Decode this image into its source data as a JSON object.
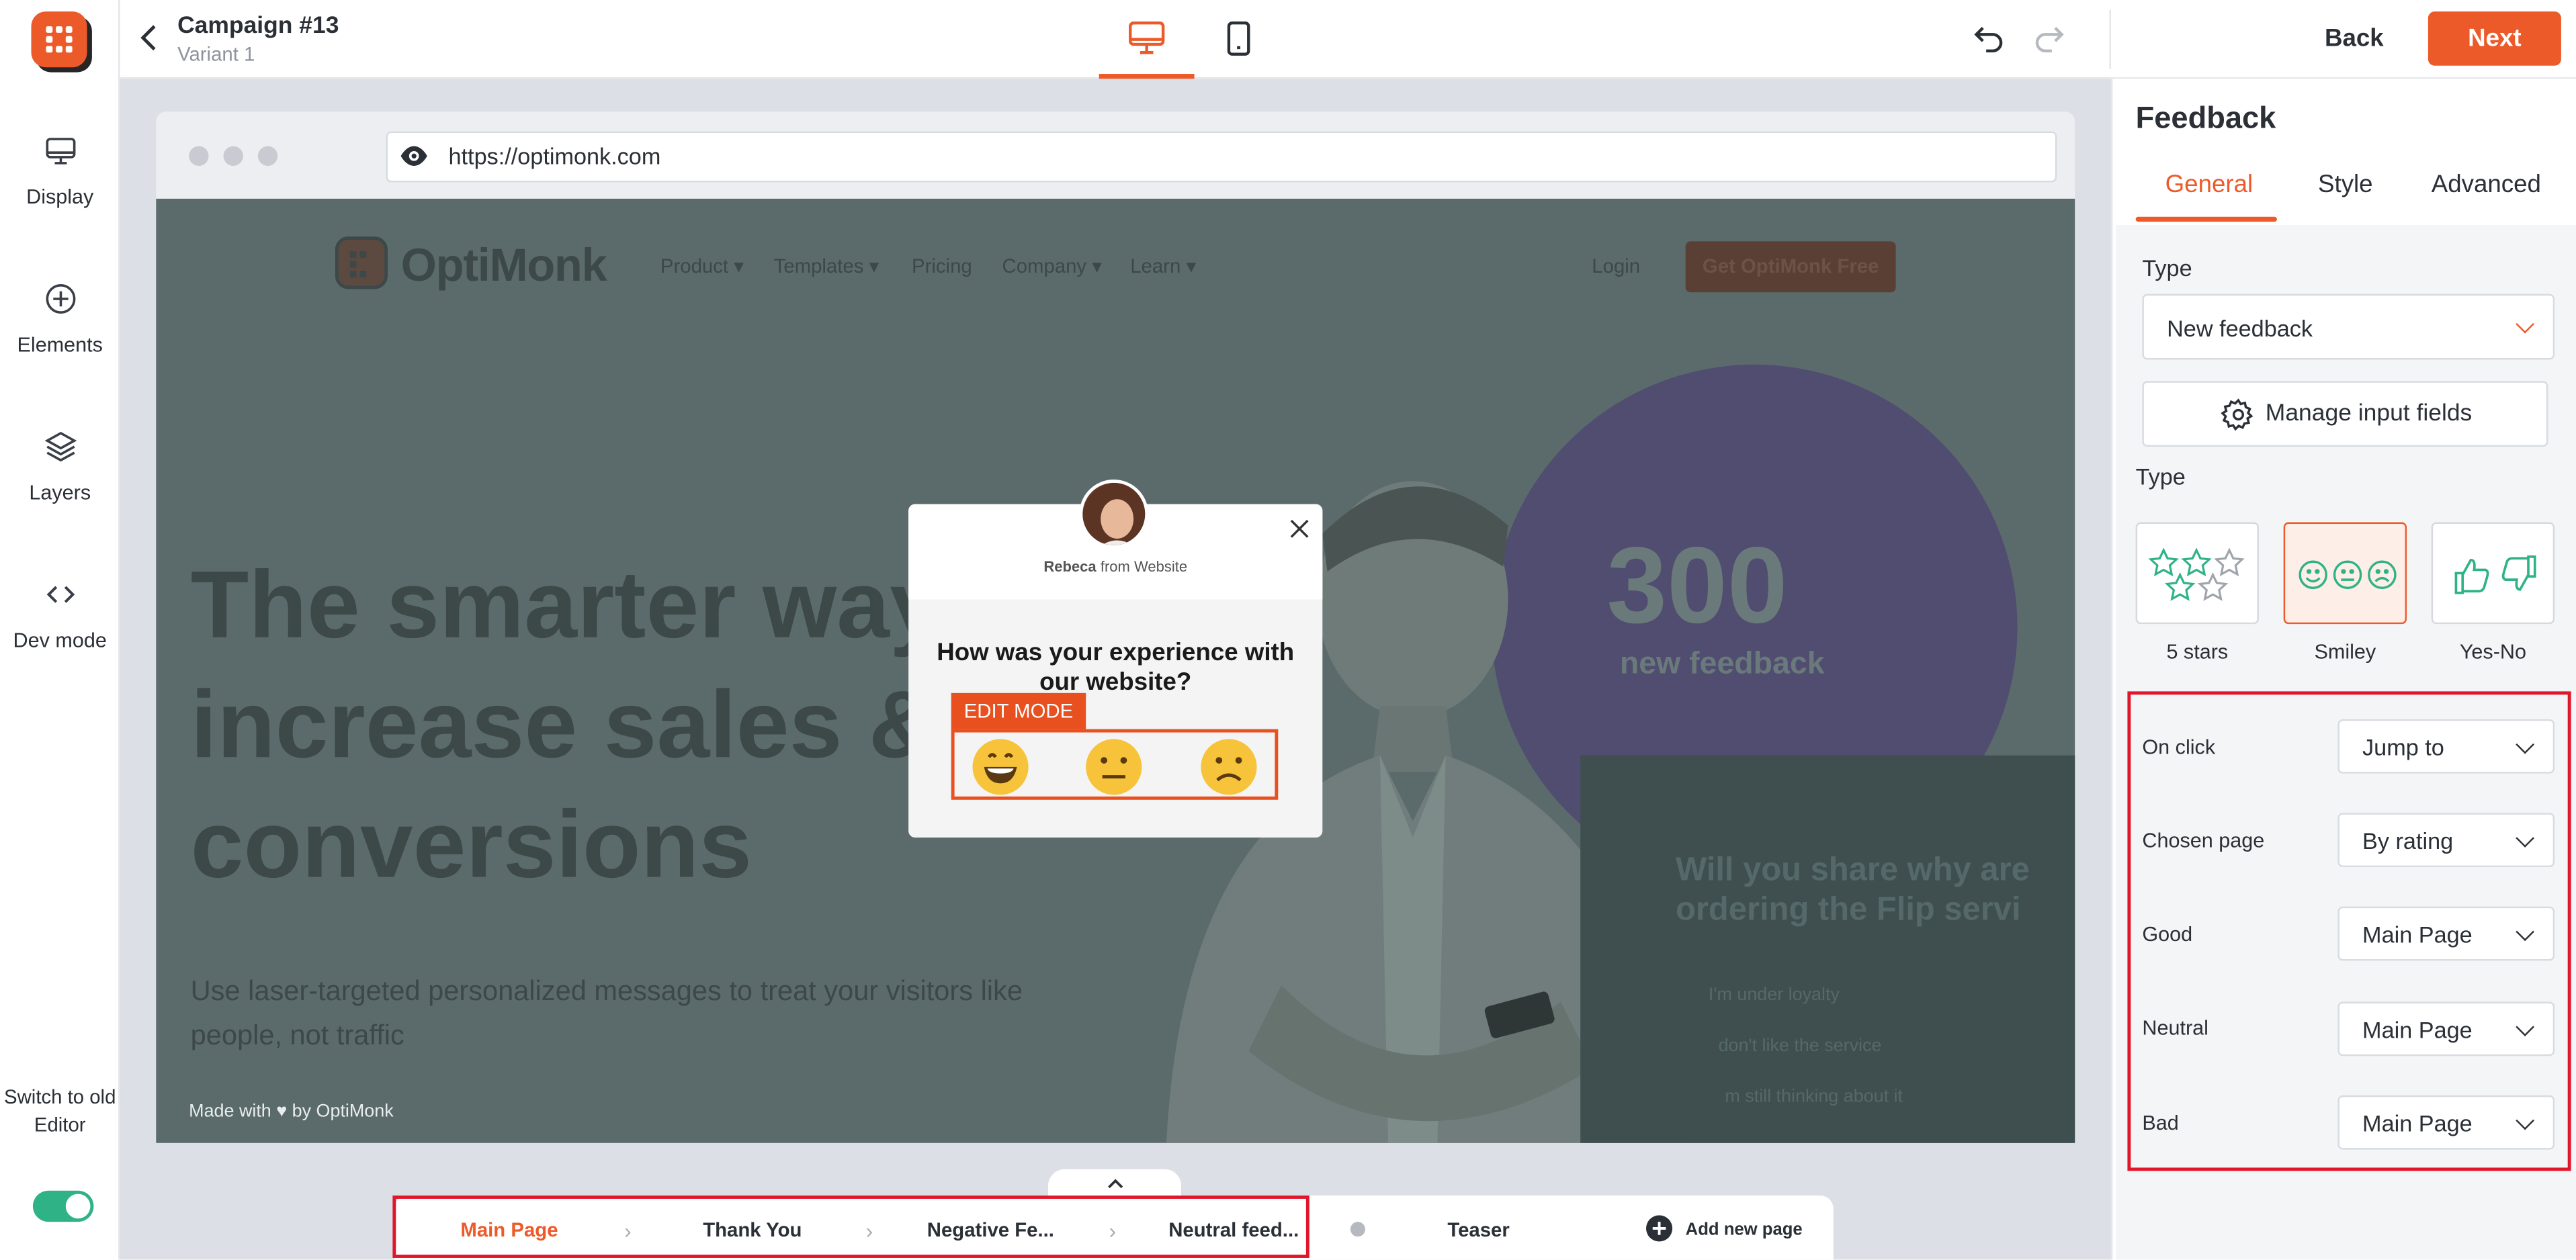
{
  "sidebar": {
    "items": [
      {
        "label": "Display",
        "icon": "monitor-icon"
      },
      {
        "label": "Elements",
        "icon": "plus-circle-icon"
      },
      {
        "label": "Layers",
        "icon": "layers-icon"
      },
      {
        "label": "Dev mode",
        "icon": "code-icon"
      }
    ],
    "switch_label": "Switch to old Editor",
    "switch_on": true
  },
  "header": {
    "title": "Campaign #13",
    "subtitle": "Variant 1",
    "back_label": "Back",
    "next_label": "Next"
  },
  "colors": {
    "accent": "#ed5a29",
    "toggle": "#2fb386",
    "highlight": "#e0162b"
  },
  "preview": {
    "url": "https://optimonk.com",
    "site": {
      "logo": "OptiMonk",
      "menu": [
        "Product",
        "Templates",
        "Pricing",
        "Company",
        "Learn"
      ],
      "login": "Login",
      "cta": "Get OptiMonk Free",
      "hero_title": "The smarter way\nincrease sales & c\nconversions",
      "hero_sub": "Use laser-targeted personalized messages to treat your visitors like people, not traffic",
      "stat_number": "300",
      "stat_label": "new feedback",
      "survey_q": "Will you share why are\nordering the Flip servi",
      "survey_opts": [
        "I'm under loyalty",
        "don't like the service",
        "m still thinking about it"
      ],
      "made_with": "Made with ♥ by OptiMonk"
    },
    "popup": {
      "name": "Rebeca",
      "from": "from Website",
      "question": "How was your experience with our website?",
      "edit_badge": "EDIT MODE",
      "smileys": [
        "😁",
        "😐",
        "☹"
      ]
    }
  },
  "pages": {
    "tabs": [
      "Main Page",
      "Thank You",
      "Negative Fe...",
      "Neutral feed..."
    ],
    "active": "Main Page",
    "teaser": "Teaser",
    "add_label": "Add new page"
  },
  "panel": {
    "title": "Feedback",
    "tabs": [
      "General",
      "Style",
      "Advanced"
    ],
    "active_tab": "General",
    "type_label": "Type",
    "type_value": "New feedback",
    "manage_label": "Manage input fields",
    "type2_label": "Type",
    "type_options": [
      {
        "label": "5 stars",
        "active": false
      },
      {
        "label": "Smiley",
        "active": true
      },
      {
        "label": "Yes-No",
        "active": false
      }
    ],
    "rows": [
      {
        "label": "On click",
        "value": "Jump to"
      },
      {
        "label": "Chosen page",
        "value": "By rating"
      },
      {
        "label": "Good",
        "value": "Main Page"
      },
      {
        "label": "Neutral",
        "value": "Main Page"
      },
      {
        "label": "Bad",
        "value": "Main Page"
      }
    ]
  }
}
